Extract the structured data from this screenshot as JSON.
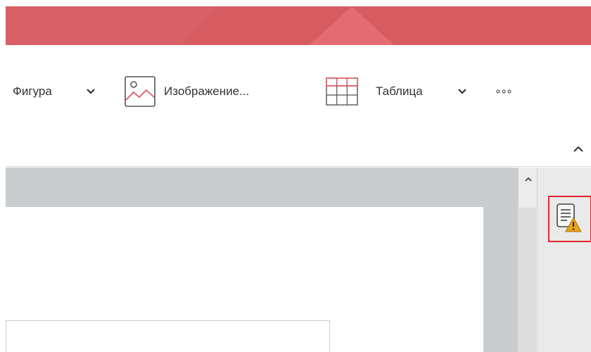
{
  "window": {
    "accent_color": "#d65c62"
  },
  "ribbon": {
    "shape": {
      "label": "Фигура",
      "icon": "chevron-down-icon"
    },
    "image": {
      "label": "Изображение...",
      "icon": "image-icon"
    },
    "table": {
      "label": "Таблица",
      "icon": "table-icon"
    },
    "more": {
      "icon": "more-icon"
    },
    "collapse": {
      "icon": "chevron-up-icon"
    }
  },
  "side_panel": {
    "document_check": {
      "icon": "document-warning-icon",
      "highlight_color": "#e0232e"
    }
  }
}
